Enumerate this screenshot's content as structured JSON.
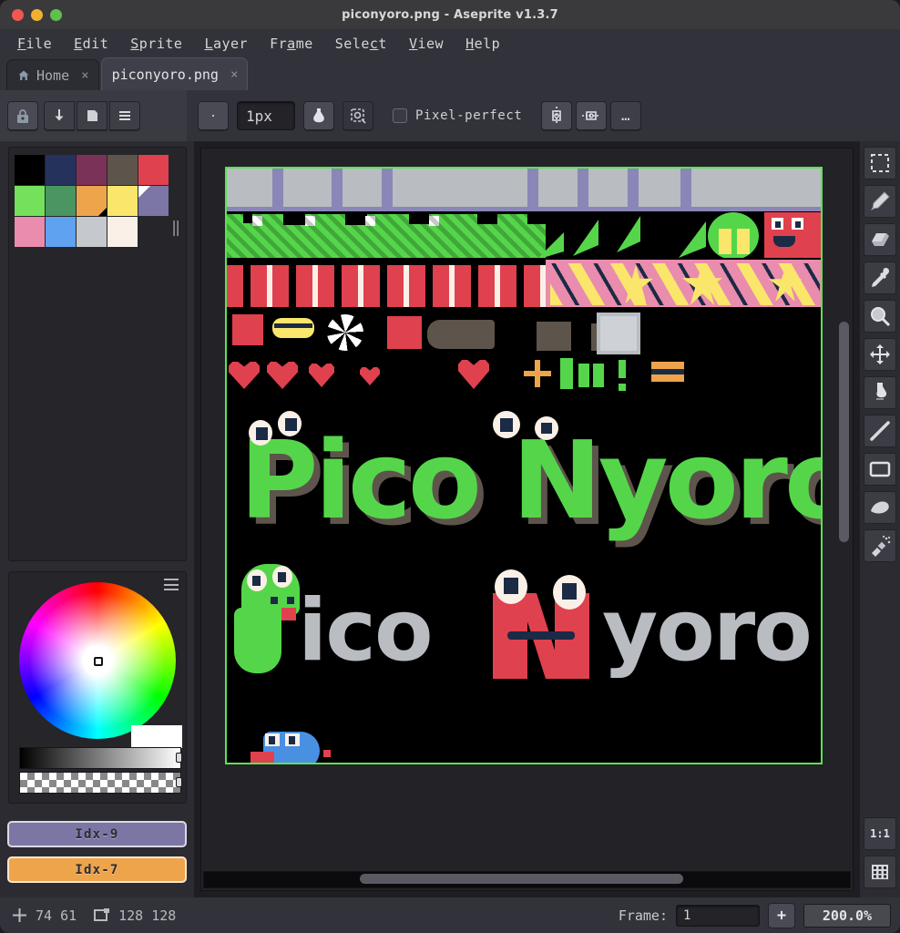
{
  "window": {
    "title": "piconyoro.png - Aseprite v1.3.7",
    "traffic_lights": [
      "close",
      "minimize",
      "maximize"
    ]
  },
  "menubar": {
    "items": [
      {
        "label": "File",
        "accel": "F"
      },
      {
        "label": "Edit",
        "accel": "E"
      },
      {
        "label": "Sprite",
        "accel": "S"
      },
      {
        "label": "Layer",
        "accel": "L"
      },
      {
        "label": "Frame",
        "accel": "a"
      },
      {
        "label": "Select",
        "accel": "c"
      },
      {
        "label": "View",
        "accel": "V"
      },
      {
        "label": "Help",
        "accel": "H"
      }
    ]
  },
  "tabs": [
    {
      "label": "Home",
      "icon": "home-icon",
      "close": "×",
      "active": false
    },
    {
      "label": "piconyoro.png",
      "icon": null,
      "close": "×",
      "active": true
    }
  ],
  "toolbar": {
    "lock_button": "lock-icon",
    "download_button": "download-icon",
    "layer_button": "layer-icon",
    "menu_button": "hamburger-icon",
    "brush_preview": "dot-brush-icon",
    "brush_size": "1px",
    "ink_button": "ink-bucket-icon",
    "symmetry_button": "symmetry-ref-icon",
    "pixel_perfect_label": "Pixel-perfect",
    "pixel_perfect_checked": false,
    "symmetry_vertical": "symmetry-vertical-icon",
    "symmetry_horizontal": "symmetry-horizontal-icon",
    "more_options": "…"
  },
  "palette": {
    "colors": [
      "#000000",
      "#25325c",
      "#7b3258",
      "#5d544c",
      "#e0414e",
      "#74e05b",
      "#4a9561",
      "#eda44b",
      "#f9e66b",
      "#7c76a5",
      "#ea8cae",
      "#5fa2ef",
      "#c5c9cd",
      "#faf0e7",
      null
    ],
    "selected_index": 9,
    "more_glyph": "‖"
  },
  "color_wheel": {
    "menu_icon": "hamburger-icon",
    "cursor_position": "center",
    "value_slider": "value-gradient",
    "alpha_slider": "alpha-checker"
  },
  "color_indices": {
    "foreground": {
      "label": "Idx-9",
      "color": "#7c76a5"
    },
    "background": {
      "label": "Idx-7",
      "color": "#eda44b"
    }
  },
  "tools": [
    {
      "name": "rectangular-marquee-tool",
      "selected": false
    },
    {
      "name": "pencil-tool",
      "selected": false
    },
    {
      "name": "eraser-tool",
      "selected": false
    },
    {
      "name": "eyedropper-tool",
      "selected": false
    },
    {
      "name": "zoom-tool",
      "selected": false
    },
    {
      "name": "move-tool",
      "selected": false
    },
    {
      "name": "paint-bucket-tool",
      "selected": false
    },
    {
      "name": "line-tool",
      "selected": false
    },
    {
      "name": "rectangle-tool",
      "selected": false
    },
    {
      "name": "contour-tool",
      "selected": false
    },
    {
      "name": "spray-tool",
      "selected": false
    }
  ],
  "canvas_buttons": {
    "fit_ratio": "1:1",
    "timeline": "film-strip-icon"
  },
  "statusbar": {
    "cursor_icon": "crosshair-icon",
    "cursor_x": "74",
    "cursor_y": "61",
    "size_icon": "canvas-size-icon",
    "sprite_width": "128",
    "sprite_height": "128",
    "frame_label": "Frame:",
    "frame_value": "1",
    "add_frame": "+",
    "zoom_level": "200.0%"
  },
  "artwork": {
    "title_text": "Pico Nyoro",
    "subtitle_text": "Pico Nyoro",
    "background": "#000000",
    "border_color": "#5ee055",
    "palette_green": "#55d64a",
    "palette_red": "#e0414e",
    "palette_grey": "#b9bcc0",
    "palette_pink": "#ea8cae",
    "palette_yellow": "#f9e66b",
    "palette_blue": "#4a90e2",
    "palette_dark": "#1b2a45",
    "palette_brown": "#5d544c",
    "palette_lavender": "#8a86b8",
    "palette_white": "#faf0e7",
    "palette_orange": "#eda44b"
  }
}
